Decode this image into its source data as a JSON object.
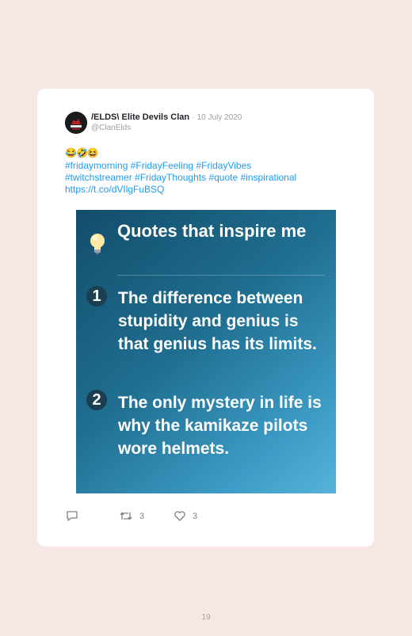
{
  "tweet": {
    "author_name": "/ELDS\\ Elite Devils Clan",
    "separator": "·",
    "date": "10 July 2020",
    "handle": "@ClanElds",
    "emoji": "😂🤣😆",
    "text_parts": [
      "#fridaymorning",
      "#FridayFeeling",
      "#FridayVibes",
      "#twitchstreamer",
      "#FridayThoughts",
      "#quote",
      "#inspirational",
      "https://t.co/dVIlgFuBSQ"
    ]
  },
  "media": {
    "heading": "Quotes that inspire me",
    "quotes": [
      {
        "number": "1",
        "text": "The difference between stupidity and genius is that genius has its limits."
      },
      {
        "number": "2",
        "text": "The only mystery in life is why the kamikaze pilots wore helmets."
      }
    ]
  },
  "actions": {
    "retweet_count": "3",
    "like_count": "3"
  },
  "colors": {
    "background": "#f6e6e4",
    "link": "#1d9bf0",
    "media_gradient_start": "#134d6b",
    "media_gradient_end": "#56b4db"
  },
  "footer": {
    "page_number": "19"
  }
}
